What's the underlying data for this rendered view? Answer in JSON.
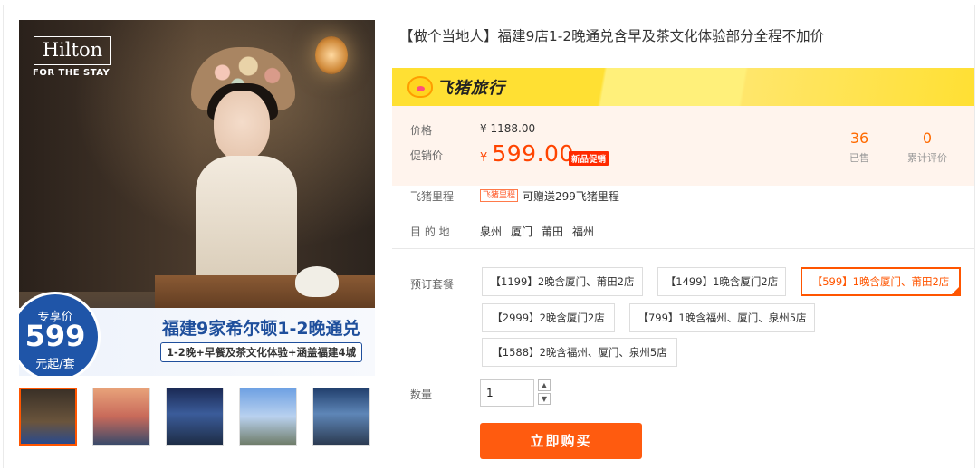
{
  "gallery": {
    "hotel_logo": "Hilton",
    "hotel_tagline": "FOR THE STAY",
    "badge": {
      "top": "专享价",
      "price": "599",
      "unit": "元起/套"
    },
    "banner_title": "福建9家希尔顿1-2晚通兑",
    "banner_sub": "1-2晚+早餐及茶文化体验+涵盖福建4城",
    "thumbnails": [
      "thumb-1",
      "thumb-2",
      "thumb-3",
      "thumb-4",
      "thumb-5"
    ]
  },
  "product": {
    "title": "【做个当地人】福建9店1-2晚通兑含早及茶文化体验部分全程不加价",
    "brand": "飞猪旅行",
    "price_label": "价格",
    "original_currency": "¥",
    "original_price": "1188.00",
    "promo_label": "促销价",
    "promo_currency": "¥",
    "promo_price": "599.00",
    "promo_tag": "新品促销",
    "sold_count": "36",
    "sold_label": "已售",
    "review_count": "0",
    "review_label": "累计评价",
    "miles_label": "飞猪里程",
    "miles_tag": "飞猪里程",
    "miles_text": "可赠送299飞猪里程",
    "dest_label": "目 的 地",
    "destinations": [
      "泉州",
      "厦门",
      "莆田",
      "福州"
    ],
    "package_label": "预订套餐",
    "packages": [
      "【1199】2晚含厦门、莆田2店",
      "【1499】1晚含厦门2店",
      "【599】1晚含厦门、莆田2店",
      "【2999】2晚含厦门2店",
      "【799】1晚含福州、厦门、泉州5店",
      "【1588】2晚含福州、厦门、泉州5店"
    ],
    "selected_package": "【599】1晚含厦门、莆田2店",
    "qty_label": "数量",
    "qty_value": "1",
    "buy_label": "立即购买"
  },
  "colors": {
    "accent": "#ff5500",
    "brand_yellow": "#ffe033",
    "promo_red": "#ff4400"
  }
}
